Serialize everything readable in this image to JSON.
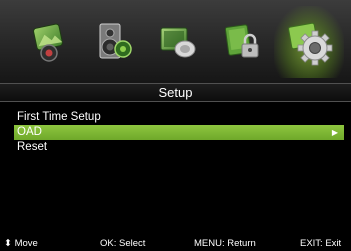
{
  "icons": [
    {
      "name": "picture-icon"
    },
    {
      "name": "sound-icon"
    },
    {
      "name": "channel-icon"
    },
    {
      "name": "lock-icon"
    },
    {
      "name": "setup-icon",
      "selected": true
    }
  ],
  "title": "Setup",
  "menu": [
    {
      "label": "First Time Setup"
    },
    {
      "label": "OAD",
      "active": true,
      "arrow": "▶"
    },
    {
      "label": "Reset"
    }
  ],
  "footer": {
    "move_symbol": "⬍",
    "move": "Move",
    "select": "OK: Select",
    "return": "MENU: Return",
    "exit": "EXIT: Exit"
  },
  "colors": {
    "accent": "#7ab833",
    "background": "#000000",
    "text": "#ffffff"
  }
}
